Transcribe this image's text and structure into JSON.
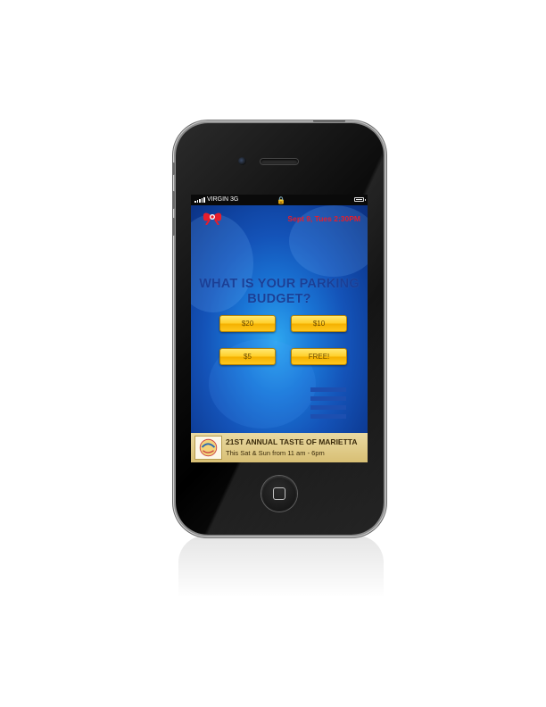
{
  "status_bar": {
    "carrier": "VIRGIN",
    "network": "3G",
    "lock_icon": "lock-icon",
    "battery_icon": "battery-icon",
    "signal_icon": "signal-icon"
  },
  "header": {
    "logo_icon": "bow-logo-icon",
    "date_time": "Sept 9, Tues 2:30PM",
    "date_color": "#e61e2c"
  },
  "main": {
    "question": "WHAT IS YOUR PARKING BUDGET?",
    "options": [
      {
        "label": "$20"
      },
      {
        "label": "$10"
      },
      {
        "label": "$5"
      },
      {
        "label": "FREE!"
      }
    ],
    "menu_icon": "menu-icon"
  },
  "promo": {
    "title": "21ST ANNUAL TASTE OF MARIETTA",
    "subtitle": "This Sat & Sun from 11 am - 6pm"
  },
  "colors": {
    "accent_button": "#ffcf2a",
    "app_background": "#1a78d8",
    "question_text": "#1a3f96"
  }
}
